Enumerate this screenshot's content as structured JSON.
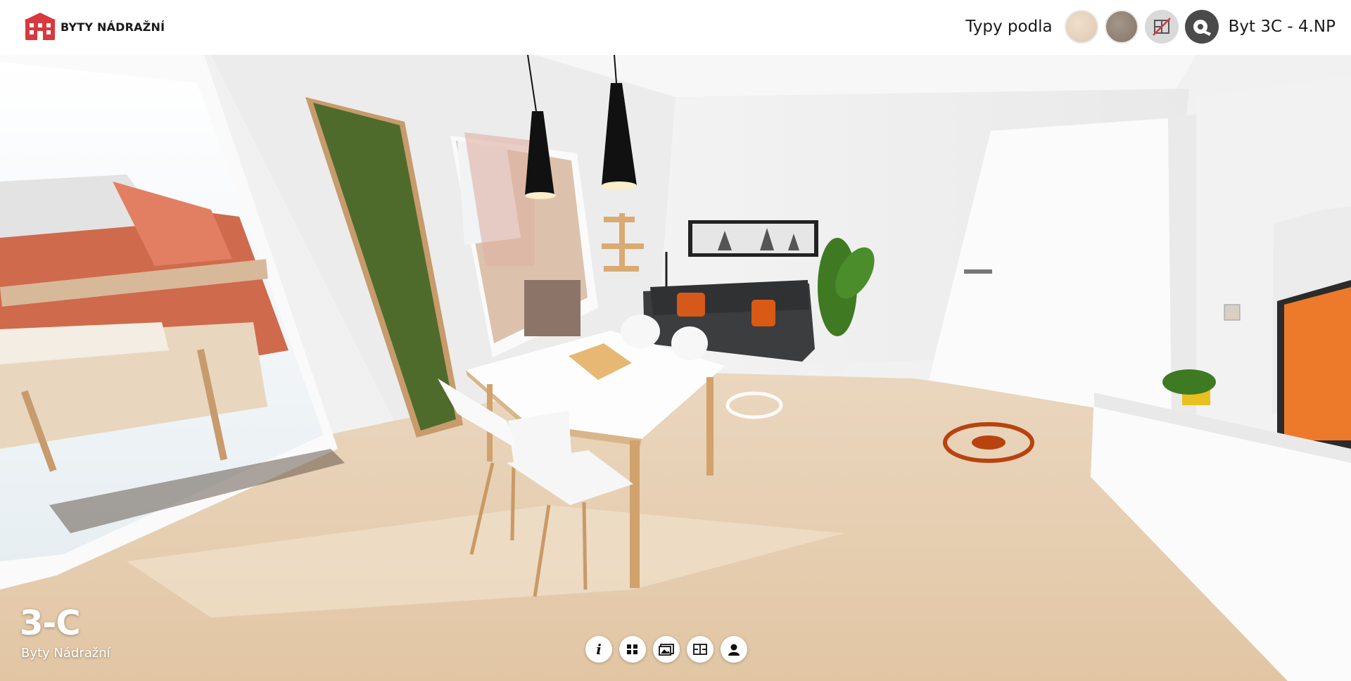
{
  "header": {
    "brand_name": "BYTY NÁDRAŽNÍ",
    "types_label": "Typy podla",
    "unit_label": "Byt 3C - 4.NP"
  },
  "controls": {
    "swatches": [
      {
        "name": "light-finish",
        "color": "#e4cfba"
      },
      {
        "name": "dark-finish",
        "color": "#93847a"
      }
    ],
    "buttons": [
      "floor-plan-toggle-icon",
      "measure-tape-icon"
    ]
  },
  "overlay": {
    "unit_code": "3-C",
    "project_name": "Byty Nádražní"
  },
  "toolbar": {
    "buttons": [
      "info-icon",
      "grid-icon",
      "gallery-icon",
      "floorplan-icon",
      "contact-icon"
    ]
  },
  "colors": {
    "brand_red": "#d8383f",
    "hotspot_orange": "#b8430f",
    "floor": "#e6cfb2"
  }
}
